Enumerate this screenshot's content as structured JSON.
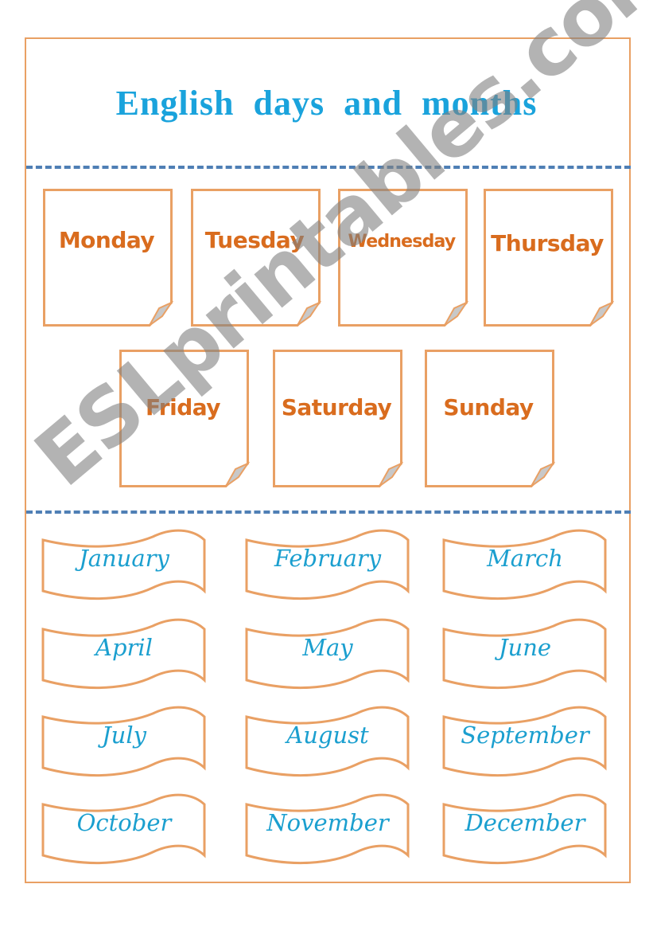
{
  "worksheet": {
    "title": "English  days  and  months",
    "colors": {
      "border": "#e9a064",
      "title": "#1aa3dc",
      "divider": "#4f7fb5",
      "day_text": "#d96c1e",
      "month_text": "#1b9fcf",
      "watermark": "#8a8a8a"
    }
  },
  "days": {
    "row1": [
      "Monday",
      "Tuesday",
      "Wednesday",
      "Thursday"
    ],
    "row2": [
      "Friday",
      "Saturday",
      "Sunday"
    ]
  },
  "months": [
    [
      "January",
      "February",
      "March"
    ],
    [
      "April",
      "May",
      "June"
    ],
    [
      "July",
      "August",
      "September"
    ],
    [
      "October",
      "November",
      "December"
    ]
  ],
  "watermark": {
    "text": "ESLprintables.com"
  }
}
